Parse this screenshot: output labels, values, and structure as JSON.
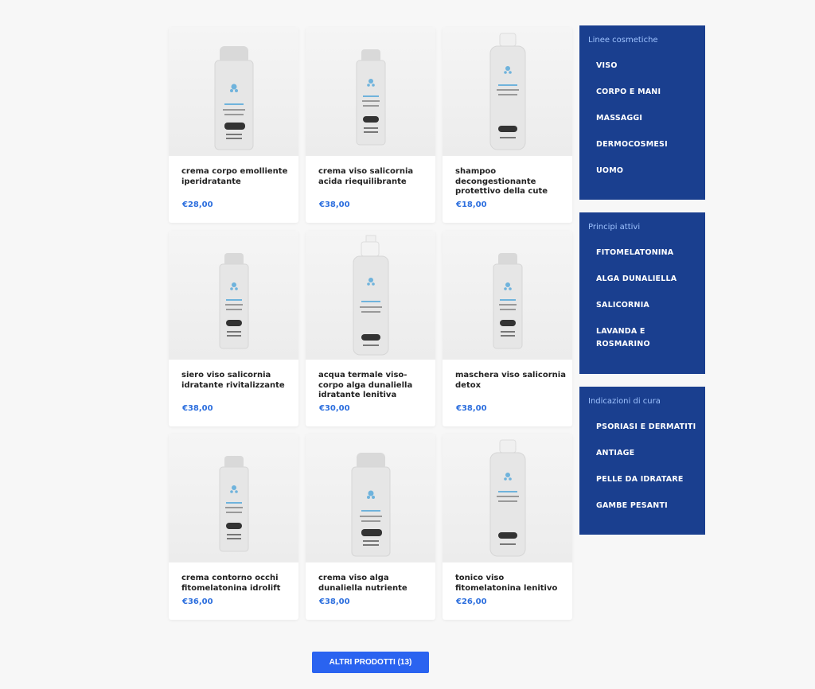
{
  "products": [
    {
      "name": "crema corpo emolliente iperidratante",
      "price": "€28,00",
      "bottle": "pump"
    },
    {
      "name": "crema viso salicornia acida riequilibrante",
      "price": "€38,00",
      "bottle": "small-pump"
    },
    {
      "name": "shampoo decongestionante protettivo della cute",
      "price": "€18,00",
      "bottle": "cap-bottle"
    },
    {
      "name": "siero viso salicornia idratante rivitalizzante",
      "price": "€38,00",
      "bottle": "small-pump"
    },
    {
      "name": "acqua termale viso-corpo alga dunaliella idratante lenitiva",
      "price": "€30,00",
      "bottle": "spray"
    },
    {
      "name": "maschera viso salicornia detox",
      "price": "€38,00",
      "bottle": "small-pump"
    },
    {
      "name": "crema contorno occhi fitomelatonina idrolift",
      "price": "€36,00",
      "bottle": "small-pump"
    },
    {
      "name": "crema viso alga dunaliella nutriente",
      "price": "€38,00",
      "bottle": "pump"
    },
    {
      "name": "tonico viso fitomelatonina lenitivo",
      "price": "€26,00",
      "bottle": "cap-bottle"
    }
  ],
  "sidebar": [
    {
      "title": "Linee cosmetiche",
      "items": [
        "VISO",
        "CORPO E MANI",
        "MASSAGGI",
        "DERMOCOSMESI",
        "UOMO"
      ]
    },
    {
      "title": "Principi attivi",
      "items": [
        "FITOMELATONINA",
        "ALGA DUNALIELLA",
        "SALICORNIA",
        "LAVANDA E ROSMARINO"
      ]
    },
    {
      "title": "Indicazioni di cura",
      "items": [
        "PSORIASI E DERMATITI",
        "ANTIAGE",
        "PELLE DA IDRATARE",
        "GAMBE PESANTI"
      ]
    }
  ],
  "more_button": "ALTRI PRODOTTI (13)",
  "colors": {
    "sidebar_bg": "#1a3f8f",
    "sidebar_heading": "#9fc3ff",
    "price": "#2d6fde",
    "button": "#2a63f0"
  }
}
